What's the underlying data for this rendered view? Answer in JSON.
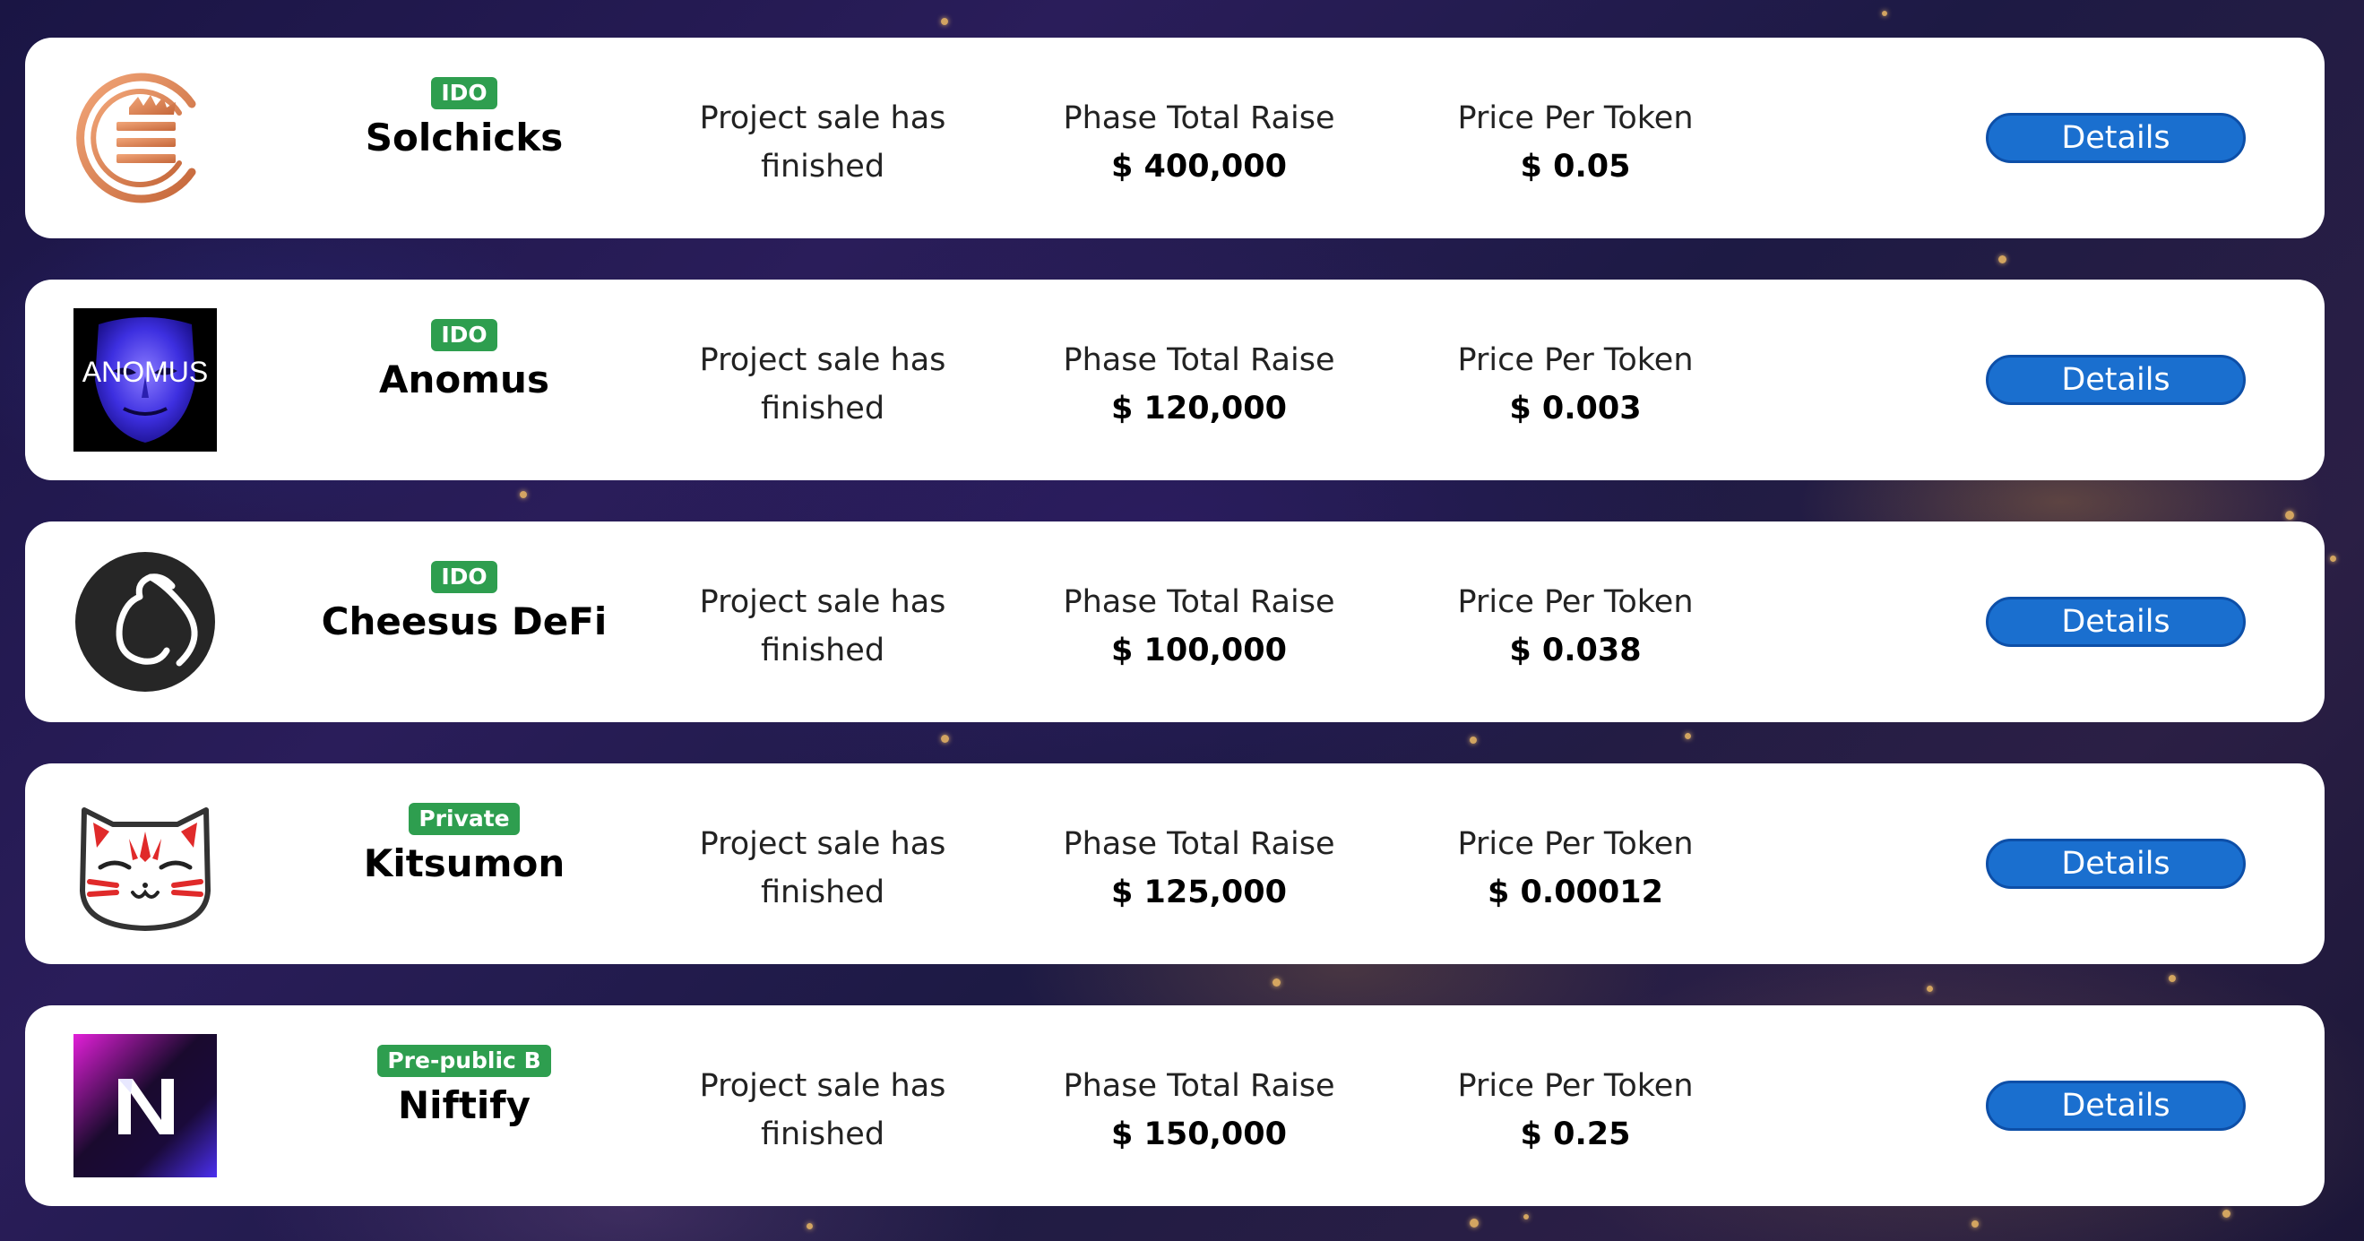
{
  "projects": [
    {
      "badge": "IDO",
      "name": "Solchicks",
      "status_line1": "Project sale has",
      "status_line2": "finished",
      "raise_label": "Phase Total Raise",
      "raise_value": "$ 400,000",
      "price_label": "Price Per Token",
      "price_value": "$ 0.05",
      "details_label": "Details",
      "logo_icon": "solchicks-logo-icon"
    },
    {
      "badge": "IDO",
      "name": "Anomus",
      "status_line1": "Project sale has",
      "status_line2": "finished",
      "raise_label": "Phase Total Raise",
      "raise_value": "$ 120,000",
      "price_label": "Price Per Token",
      "price_value": "$ 0.003",
      "details_label": "Details",
      "logo_text": "ANOMUS",
      "logo_icon": "anomus-mask-logo-icon"
    },
    {
      "badge": "IDO",
      "name": "Cheesus DeFi",
      "status_line1": "Project sale has",
      "status_line2": "finished",
      "raise_label": "Phase Total Raise",
      "raise_value": "$ 100,000",
      "price_label": "Price Per Token",
      "price_value": "$ 0.038",
      "details_label": "Details",
      "logo_icon": "cheesus-defi-logo-icon"
    },
    {
      "badge": "Private",
      "name": "Kitsumon",
      "status_line1": "Project sale has",
      "status_line2": "finished",
      "raise_label": "Phase Total Raise",
      "raise_value": "$ 125,000",
      "price_label": "Price Per Token",
      "price_value": "$ 0.00012",
      "details_label": "Details",
      "logo_icon": "kitsune-mask-logo-icon"
    },
    {
      "badge": "Pre-public B",
      "name": "Niftify",
      "status_line1": "Project sale has",
      "status_line2": "finished",
      "raise_label": "Phase Total Raise",
      "raise_value": "$ 150,000",
      "price_label": "Price Per Token",
      "price_value": "$ 0.25",
      "details_label": "Details",
      "logo_icon": "niftify-n-logo-icon"
    }
  ],
  "colors": {
    "badge_green": "#2e9e4f",
    "button_blue": "#1a6fcf",
    "card_bg": "#ffffff"
  }
}
